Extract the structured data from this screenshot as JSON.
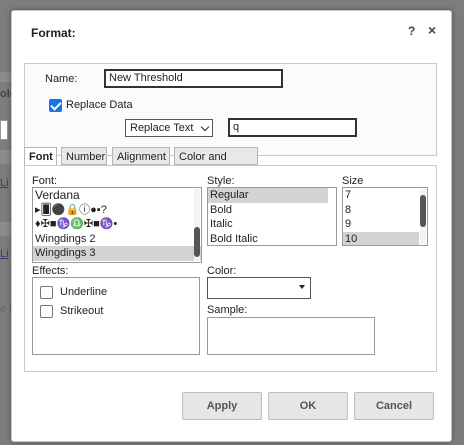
{
  "background": {
    "fragments": [
      "old",
      "Li",
      "Li",
      "e R"
    ]
  },
  "dialog": {
    "title": "Format:",
    "help_label": "?",
    "close_label": "×"
  },
  "top": {
    "name_label": "Name:",
    "name_value": "New Threshold",
    "replace_data_label": "Replace Data",
    "replace_data_checked": true,
    "replace_mode_selected": "Replace Text",
    "replace_value": "q"
  },
  "tabs": [
    "Font",
    "Number",
    "Alignment",
    "Color and Lines"
  ],
  "active_tab": "Font",
  "font_tab": {
    "font_label": "Font:",
    "fonts": [
      "Verdana",
      "▸🂠⚫🔒ⓘ●▪?",
      "♦✠■♑♎✠■♑•",
      "Wingdings 2",
      "Wingdings 3"
    ],
    "selected_font": "Wingdings 3",
    "style_label": "Style:",
    "styles": [
      "Regular",
      "Bold",
      "Italic",
      "Bold Italic"
    ],
    "selected_style": "Regular",
    "size_label": "Size",
    "sizes": [
      "7",
      "8",
      "9",
      "10"
    ],
    "selected_size": "10",
    "effects_label": "Effects:",
    "underline_label": "Underline",
    "strikeout_label": "Strikeout",
    "color_label": "Color:",
    "sample_label": "Sample:"
  },
  "buttons": {
    "apply": "Apply",
    "ok": "OK",
    "cancel": "Cancel"
  }
}
